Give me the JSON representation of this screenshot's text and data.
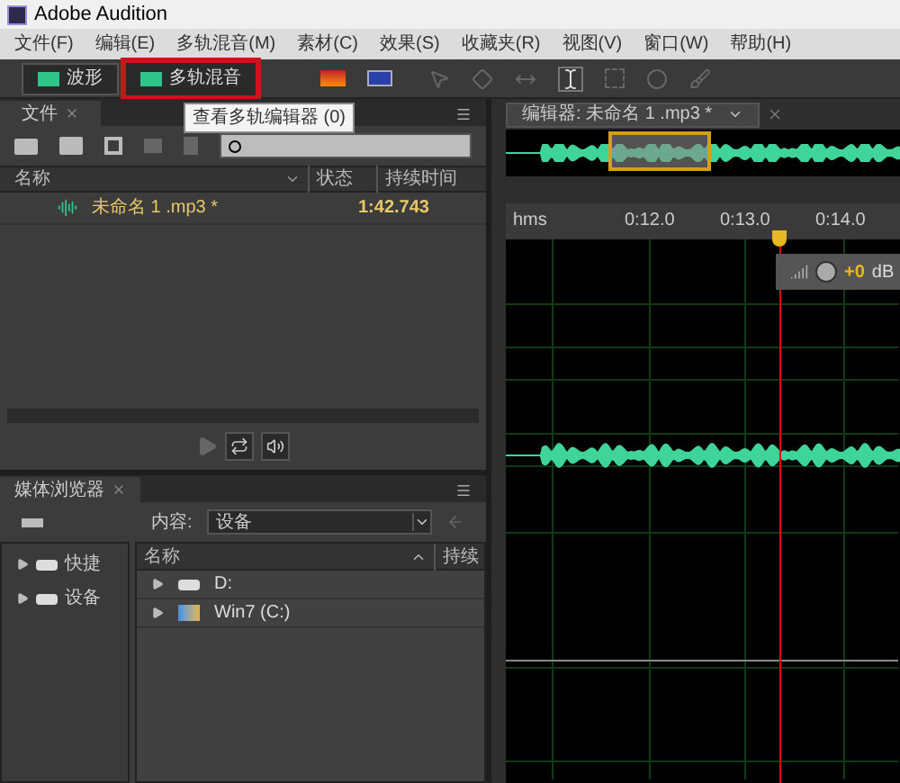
{
  "window": {
    "title": "Adobe Audition"
  },
  "menu": [
    "文件(F)",
    "编辑(E)",
    "多轨混音(M)",
    "素材(C)",
    "效果(S)",
    "收藏夹(R)",
    "视图(V)",
    "窗口(W)",
    "帮助(H)"
  ],
  "view_buttons": [
    {
      "label": "波形",
      "highlighted": false
    },
    {
      "label": "多轨混音",
      "highlighted": true
    }
  ],
  "tooltip": "查看多轨编辑器 (0)",
  "files_panel": {
    "tab": "文件",
    "columns": [
      "名称",
      "状态",
      "持续时间"
    ],
    "rows": [
      {
        "name": "未命名 1 .mp3 *",
        "duration": "1:42.743"
      }
    ]
  },
  "media_browser": {
    "tab": "媒体浏览器",
    "content_label": "内容:",
    "content_value": "设备",
    "tree": [
      "快捷",
      "设备"
    ],
    "columns": [
      "名称",
      "持续"
    ],
    "items": [
      {
        "kind": "drive",
        "label": "D:"
      },
      {
        "kind": "system",
        "label": "Win7 (C:)"
      }
    ]
  },
  "editor": {
    "tab": "编辑器: 未命名 1 .mp3 *",
    "ruler": [
      "hms",
      "0:12.0",
      "0:13.0",
      "0:14.0"
    ],
    "gain": "+0",
    "gain_unit": "dB"
  }
}
